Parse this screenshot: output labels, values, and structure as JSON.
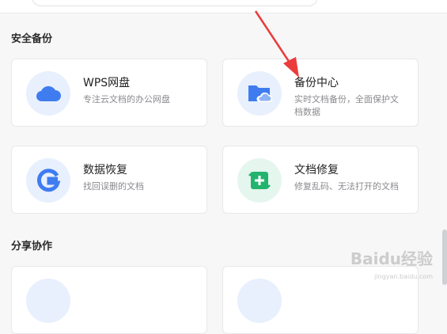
{
  "sections": {
    "backup": {
      "title": "安全备份"
    },
    "share": {
      "title": "分享协作"
    }
  },
  "cards": {
    "wps_cloud": {
      "title": "WPS网盘",
      "desc": "专注云文档的办公网盘"
    },
    "backup_center": {
      "title": "备份中心",
      "desc": "实时文档备份，全面保护文档数据"
    },
    "data_recovery": {
      "title": "数据恢复",
      "desc": "找回误删的文档"
    },
    "doc_repair": {
      "title": "文档修复",
      "desc": "修复乱码、无法打开的文档"
    }
  },
  "colors": {
    "blue_icon": "#3f7cf0",
    "blue_icon_bg": "#e8f0fd",
    "green_icon": "#22b36e",
    "green_icon_bg": "#e5f6ee",
    "arrow": "#ea3c3c"
  },
  "icons": {
    "wps_cloud": "cloud-icon",
    "backup_center": "folder-cloud-icon",
    "data_recovery": "g-logo-icon",
    "doc_repair": "document-repair-icon"
  },
  "watermark": {
    "text": "Baidu经验",
    "sub": "jingyan.baidu.com"
  }
}
